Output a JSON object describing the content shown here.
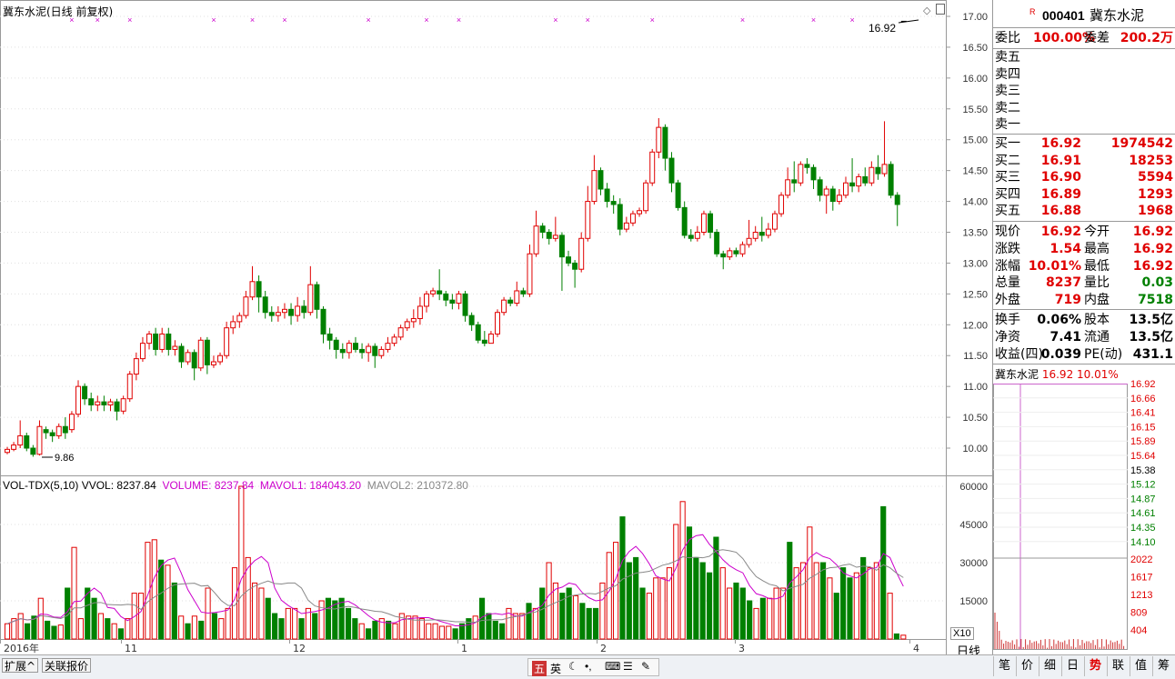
{
  "header": {
    "title": "冀东水泥(日线 前复权)",
    "price_tag": "16.92",
    "low_tag": "9.86"
  },
  "price_axis": [
    "17.00",
    "16.50",
    "16.00",
    "15.50",
    "15.00",
    "14.50",
    "14.00",
    "13.50",
    "13.00",
    "12.50",
    "12.00",
    "11.50",
    "11.00",
    "10.50",
    "10.00"
  ],
  "vol_axis": [
    "60000",
    "45000",
    "30000",
    "15000"
  ],
  "vol_multiplier": "X10",
  "vol_header": {
    "name": "VOL-TDX(5,10)",
    "vvol_label": "VVOL:",
    "vvol_value": "8237.84",
    "volume": "VOLUME: 8237.84",
    "mavol1": "MAVOL1: 184043.20",
    "mavol2": "MAVOL2: 210372.80"
  },
  "date_axis": [
    "2016年",
    "11",
    "12",
    "1",
    "2",
    "3",
    "4"
  ],
  "period_label": "日线",
  "bottom_tabs": [
    "扩展^",
    "关联报价"
  ],
  "ime_toolbar": [
    "五",
    "英"
  ],
  "colors": {
    "up": "#e00000",
    "down": "#008000",
    "mavol1": "#cc00cc",
    "mavol2": "#888888",
    "marker": "#cc00cc",
    "panel_border": "#999999"
  },
  "quote": {
    "code": "000401",
    "name": "冀东水泥",
    "badge": "R",
    "weibi_label": "委比",
    "weibi": "100.00%",
    "weicha_label": "委差",
    "weicha": "200.2万",
    "sell": [
      {
        "label": "卖五"
      },
      {
        "label": "卖四"
      },
      {
        "label": "卖三"
      },
      {
        "label": "卖二"
      },
      {
        "label": "卖一"
      }
    ],
    "buy": [
      {
        "label": "买一",
        "price": "16.92",
        "vol": "1974542"
      },
      {
        "label": "买二",
        "price": "16.91",
        "vol": "18253"
      },
      {
        "label": "买三",
        "price": "16.90",
        "vol": "5594"
      },
      {
        "label": "买四",
        "price": "16.89",
        "vol": "1293"
      },
      {
        "label": "买五",
        "price": "16.88",
        "vol": "1968"
      }
    ],
    "stats": [
      {
        "l1": "现价",
        "v1": "16.92",
        "l2": "今开",
        "v2": "16.92"
      },
      {
        "l1": "涨跌",
        "v1": "1.54",
        "l2": "最高",
        "v2": "16.92"
      },
      {
        "l1": "涨幅",
        "v1": "10.01%",
        "l2": "最低",
        "v2": "16.92"
      },
      {
        "l1": "总量",
        "v1": "8237",
        "l2": "量比",
        "v2": "0.03"
      },
      {
        "l1": "外盘",
        "v1": "719",
        "l2": "内盘",
        "v2": "7518"
      }
    ],
    "fund": [
      {
        "l1": "换手",
        "v1": "0.06%",
        "l2": "股本",
        "v2": "13.5亿"
      },
      {
        "l1": "净资",
        "v1": "7.41",
        "l2": "流通",
        "v2": "13.5亿"
      },
      {
        "l1": "收益(四)",
        "v1": "0.039",
        "l2": "PE(动)",
        "v2": "431.1"
      }
    ]
  },
  "intraday": {
    "title": "冀东水泥",
    "price": "16.92",
    "pct": "10.01%",
    "price_axis": [
      "16.92",
      "16.66",
      "16.41",
      "16.15",
      "15.89",
      "15.64",
      "15.38",
      "15.12",
      "14.87",
      "14.61",
      "14.35",
      "14.10"
    ],
    "vol_axis": [
      "2022",
      "1617",
      "1213",
      "809",
      "404"
    ]
  },
  "right_tabs": [
    "笔",
    "价",
    "细",
    "日",
    "势",
    "联",
    "值",
    "筹"
  ],
  "chart_data": {
    "type": "candlestick",
    "title": "冀东水泥(日线 前复权)",
    "ylim": [
      9.5,
      17.2
    ],
    "candles": [
      [
        9.93,
        9.98,
        9.9,
        10.02
      ],
      [
        9.98,
        10.05,
        9.95,
        10.1
      ],
      [
        10.05,
        10.2,
        10.0,
        10.45
      ],
      [
        10.2,
        10.0,
        9.95,
        10.25
      ],
      [
        10.0,
        9.9,
        9.86,
        10.05
      ],
      [
        9.9,
        10.35,
        9.88,
        10.45
      ],
      [
        10.3,
        10.25,
        10.15,
        10.35
      ],
      [
        10.25,
        10.2,
        10.1,
        10.3
      ],
      [
        10.2,
        10.35,
        10.15,
        10.4
      ],
      [
        10.35,
        10.25,
        10.15,
        10.5
      ],
      [
        10.3,
        10.55,
        10.25,
        10.6
      ],
      [
        10.55,
        11.0,
        10.5,
        11.1
      ],
      [
        11.0,
        10.8,
        10.7,
        11.05
      ],
      [
        10.8,
        10.7,
        10.6,
        10.9
      ],
      [
        10.7,
        10.75,
        10.6,
        10.85
      ],
      [
        10.75,
        10.7,
        10.6,
        10.85
      ],
      [
        10.7,
        10.75,
        10.6,
        10.8
      ],
      [
        10.75,
        10.6,
        10.45,
        10.8
      ],
      [
        10.6,
        10.8,
        10.55,
        10.85
      ],
      [
        10.8,
        11.2,
        10.75,
        11.25
      ],
      [
        11.2,
        11.45,
        11.1,
        11.55
      ],
      [
        11.45,
        11.7,
        11.4,
        11.8
      ],
      [
        11.7,
        11.85,
        11.6,
        11.9
      ],
      [
        11.85,
        11.6,
        11.5,
        11.95
      ],
      [
        11.6,
        11.85,
        11.55,
        11.95
      ],
      [
        11.85,
        11.6,
        11.5,
        11.95
      ],
      [
        11.6,
        11.65,
        11.5,
        11.75
      ],
      [
        11.65,
        11.4,
        11.3,
        11.7
      ],
      [
        11.4,
        11.55,
        11.35,
        11.6
      ],
      [
        11.55,
        11.3,
        11.1,
        11.6
      ],
      [
        11.3,
        11.75,
        11.25,
        11.8
      ],
      [
        11.75,
        11.35,
        11.2,
        11.8
      ],
      [
        11.35,
        11.4,
        11.3,
        11.5
      ],
      [
        11.4,
        11.5,
        11.35,
        11.55
      ],
      [
        11.5,
        11.95,
        11.45,
        12.05
      ],
      [
        11.95,
        12.05,
        11.85,
        12.15
      ],
      [
        12.05,
        12.15,
        11.95,
        12.2
      ],
      [
        12.15,
        12.45,
        12.1,
        12.55
      ],
      [
        12.45,
        12.7,
        12.4,
        12.95
      ],
      [
        12.7,
        12.45,
        12.2,
        12.8
      ],
      [
        12.45,
        12.2,
        12.1,
        12.55
      ],
      [
        12.2,
        12.15,
        12.05,
        12.3
      ],
      [
        12.15,
        12.2,
        12.05,
        12.3
      ],
      [
        12.2,
        12.25,
        12.1,
        12.35
      ],
      [
        12.25,
        12.15,
        12.0,
        12.35
      ],
      [
        12.15,
        12.3,
        12.05,
        12.45
      ],
      [
        12.3,
        12.2,
        12.1,
        12.4
      ],
      [
        12.2,
        12.65,
        12.15,
        12.95
      ],
      [
        12.65,
        12.25,
        12.1,
        12.7
      ],
      [
        12.25,
        11.85,
        11.7,
        12.3
      ],
      [
        11.85,
        11.75,
        11.6,
        11.95
      ],
      [
        11.75,
        11.6,
        11.45,
        11.8
      ],
      [
        11.6,
        11.55,
        11.45,
        11.7
      ],
      [
        11.55,
        11.7,
        11.45,
        11.75
      ],
      [
        11.7,
        11.6,
        11.55,
        11.8
      ],
      [
        11.6,
        11.55,
        11.45,
        11.7
      ],
      [
        11.55,
        11.65,
        11.4,
        11.7
      ],
      [
        11.65,
        11.5,
        11.3,
        11.7
      ],
      [
        11.5,
        11.6,
        11.45,
        11.65
      ],
      [
        11.6,
        11.7,
        11.55,
        11.8
      ],
      [
        11.7,
        11.8,
        11.65,
        11.85
      ],
      [
        11.8,
        11.95,
        11.75,
        12.0
      ],
      [
        11.95,
        12.05,
        11.9,
        12.1
      ],
      [
        12.05,
        12.1,
        11.95,
        12.25
      ],
      [
        12.1,
        12.3,
        12.0,
        12.45
      ],
      [
        12.3,
        12.5,
        12.2,
        12.55
      ],
      [
        12.5,
        12.55,
        12.45,
        12.6
      ],
      [
        12.55,
        12.5,
        12.4,
        12.9
      ],
      [
        12.5,
        12.4,
        12.3,
        12.55
      ],
      [
        12.4,
        12.35,
        12.25,
        12.5
      ],
      [
        12.35,
        12.5,
        12.25,
        12.55
      ],
      [
        12.5,
        12.15,
        12.05,
        12.55
      ],
      [
        12.15,
        12.0,
        11.9,
        12.2
      ],
      [
        12.0,
        11.75,
        11.7,
        12.05
      ],
      [
        11.75,
        11.7,
        11.65,
        11.9
      ],
      [
        11.7,
        11.85,
        11.7,
        11.9
      ],
      [
        11.85,
        12.2,
        11.8,
        12.25
      ],
      [
        12.2,
        12.4,
        12.15,
        12.45
      ],
      [
        12.4,
        12.35,
        12.3,
        12.45
      ],
      [
        12.35,
        12.55,
        12.3,
        12.7
      ],
      [
        12.55,
        12.5,
        12.45,
        12.6
      ],
      [
        12.5,
        13.15,
        12.45,
        13.3
      ],
      [
        13.15,
        13.6,
        13.1,
        13.85
      ],
      [
        13.6,
        13.5,
        13.4,
        13.65
      ],
      [
        13.5,
        13.4,
        13.3,
        13.55
      ],
      [
        13.4,
        13.45,
        13.35,
        13.75
      ],
      [
        13.45,
        13.1,
        12.55,
        13.5
      ],
      [
        13.1,
        13.0,
        12.95,
        13.2
      ],
      [
        13.0,
        12.9,
        12.6,
        13.05
      ],
      [
        12.9,
        13.4,
        12.85,
        13.5
      ],
      [
        13.4,
        14.0,
        13.35,
        14.25
      ],
      [
        14.0,
        14.5,
        13.95,
        14.75
      ],
      [
        14.5,
        14.2,
        14.1,
        14.55
      ],
      [
        14.2,
        14.0,
        13.9,
        14.3
      ],
      [
        14.0,
        13.95,
        13.8,
        14.1
      ],
      [
        13.95,
        13.55,
        13.45,
        14.05
      ],
      [
        13.55,
        13.65,
        13.5,
        13.75
      ],
      [
        13.65,
        13.8,
        13.6,
        13.85
      ],
      [
        13.8,
        13.85,
        13.75,
        13.9
      ],
      [
        13.85,
        14.3,
        13.8,
        14.35
      ],
      [
        14.3,
        14.8,
        14.25,
        14.85
      ],
      [
        14.8,
        15.2,
        14.7,
        15.35
      ],
      [
        15.2,
        14.7,
        14.5,
        15.25
      ],
      [
        14.7,
        14.3,
        14.15,
        14.8
      ],
      [
        14.3,
        13.9,
        13.85,
        14.35
      ],
      [
        13.9,
        13.45,
        13.4,
        14.0
      ],
      [
        13.45,
        13.4,
        13.35,
        13.55
      ],
      [
        13.4,
        13.5,
        13.35,
        13.6
      ],
      [
        13.5,
        13.8,
        13.45,
        13.85
      ],
      [
        13.8,
        13.5,
        13.4,
        13.85
      ],
      [
        13.5,
        13.15,
        13.1,
        13.55
      ],
      [
        13.15,
        13.1,
        12.9,
        13.2
      ],
      [
        13.1,
        13.2,
        13.05,
        13.25
      ],
      [
        13.2,
        13.15,
        13.1,
        13.25
      ],
      [
        13.15,
        13.3,
        13.1,
        13.35
      ],
      [
        13.3,
        13.4,
        13.25,
        13.7
      ],
      [
        13.4,
        13.5,
        13.35,
        13.6
      ],
      [
        13.5,
        13.45,
        13.35,
        13.75
      ],
      [
        13.45,
        13.55,
        13.4,
        13.65
      ],
      [
        13.55,
        13.8,
        13.5,
        13.85
      ],
      [
        13.8,
        14.1,
        13.75,
        14.15
      ],
      [
        14.1,
        14.35,
        14.05,
        14.55
      ],
      [
        14.35,
        14.3,
        14.15,
        14.65
      ],
      [
        14.3,
        14.6,
        14.25,
        14.65
      ],
      [
        14.6,
        14.55,
        14.45,
        14.7
      ],
      [
        14.55,
        14.35,
        14.2,
        14.6
      ],
      [
        14.35,
        14.1,
        14.0,
        14.4
      ],
      [
        14.1,
        14.2,
        13.8,
        14.25
      ],
      [
        14.2,
        14.0,
        13.85,
        14.25
      ],
      [
        14.0,
        14.1,
        13.95,
        14.2
      ],
      [
        14.1,
        14.3,
        14.05,
        14.4
      ],
      [
        14.3,
        14.25,
        14.15,
        14.7
      ],
      [
        14.25,
        14.4,
        14.15,
        14.45
      ],
      [
        14.4,
        14.3,
        14.25,
        14.55
      ],
      [
        14.3,
        14.55,
        14.25,
        14.65
      ],
      [
        14.55,
        14.45,
        14.35,
        14.75
      ],
      [
        14.45,
        14.6,
        14.4,
        15.3
      ],
      [
        14.6,
        14.1,
        14.05,
        14.65
      ],
      [
        14.1,
        13.95,
        13.6,
        14.15
      ],
      [
        16.92,
        16.92,
        16.92,
        16.92
      ]
    ],
    "volume": {
      "ylim": [
        0,
        65000
      ],
      "values": [
        6000,
        8000,
        10000,
        6000,
        9000,
        16000,
        7000,
        5000,
        5500,
        20000,
        36000,
        8000,
        20000,
        16000,
        10000,
        8000,
        6000,
        4000,
        8000,
        18000,
        18000,
        38000,
        39000,
        31000,
        29000,
        22000,
        9000,
        6000,
        9000,
        7000,
        20000,
        10000,
        8000,
        12000,
        28000,
        60000,
        32000,
        22000,
        20000,
        16000,
        10000,
        8000,
        12000,
        12000,
        8000,
        12000,
        10000,
        15000,
        16000,
        15000,
        16000,
        12000,
        8000,
        6000,
        4000,
        7000,
        8000,
        7000,
        6000,
        10000,
        9000,
        9000,
        8000,
        6000,
        6000,
        5000,
        5000,
        4000,
        6000,
        8000,
        9000,
        16000,
        10000,
        7000,
        6000,
        12000,
        10000,
        10000,
        14000,
        12000,
        20000,
        30000,
        22000,
        18000,
        20000,
        17000,
        14000,
        12000,
        12000,
        22000,
        34000,
        38000,
        48000,
        30000,
        32000,
        20000,
        18000,
        24000,
        24000,
        28000,
        45000,
        54000,
        44000,
        32000,
        30000,
        26000,
        40000,
        28000,
        20000,
        22000,
        20000,
        15000,
        12000,
        16000,
        16000,
        20000,
        20000,
        38000,
        28000,
        30000,
        44000,
        30000,
        30000,
        24000,
        18000,
        28000,
        24000,
        26000,
        32000,
        28000,
        30000,
        52000,
        18000,
        2000,
        1500
      ],
      "up": [
        true,
        true,
        true,
        false,
        false,
        true,
        false,
        false,
        true,
        false,
        true,
        true,
        false,
        false,
        true,
        false,
        true,
        false,
        true,
        true,
        true,
        true,
        true,
        false,
        true,
        false,
        true,
        false,
        true,
        false,
        true,
        false,
        true,
        true,
        true,
        true,
        true,
        true,
        true,
        false,
        false,
        false,
        true,
        true,
        false,
        true,
        false,
        true,
        false,
        false,
        false,
        false,
        false,
        true,
        false,
        false,
        true,
        false,
        true,
        true,
        true,
        true,
        true,
        true,
        true,
        true,
        true,
        false,
        false,
        false,
        true,
        false,
        false,
        false,
        false,
        true,
        true,
        true,
        false,
        true,
        false,
        true,
        true,
        false,
        false,
        true,
        false,
        false,
        false,
        true,
        true,
        true,
        false,
        false,
        false,
        false,
        true,
        true,
        true,
        true,
        true,
        true,
        false,
        false,
        false,
        false,
        false,
        true,
        true,
        false,
        false,
        false,
        true,
        false,
        true,
        true,
        true,
        false,
        true,
        true,
        true,
        true,
        false,
        true,
        false,
        false,
        false,
        true,
        false,
        true,
        true,
        false,
        true,
        false,
        true
      ]
    },
    "mavol1_label": "MAVOL1: 184043.20",
    "mavol2_label": "MAVOL2: 210372.80",
    "x_tick_labels": [
      "2016年",
      "11",
      "12",
      "1",
      "2",
      "3",
      "4"
    ]
  }
}
